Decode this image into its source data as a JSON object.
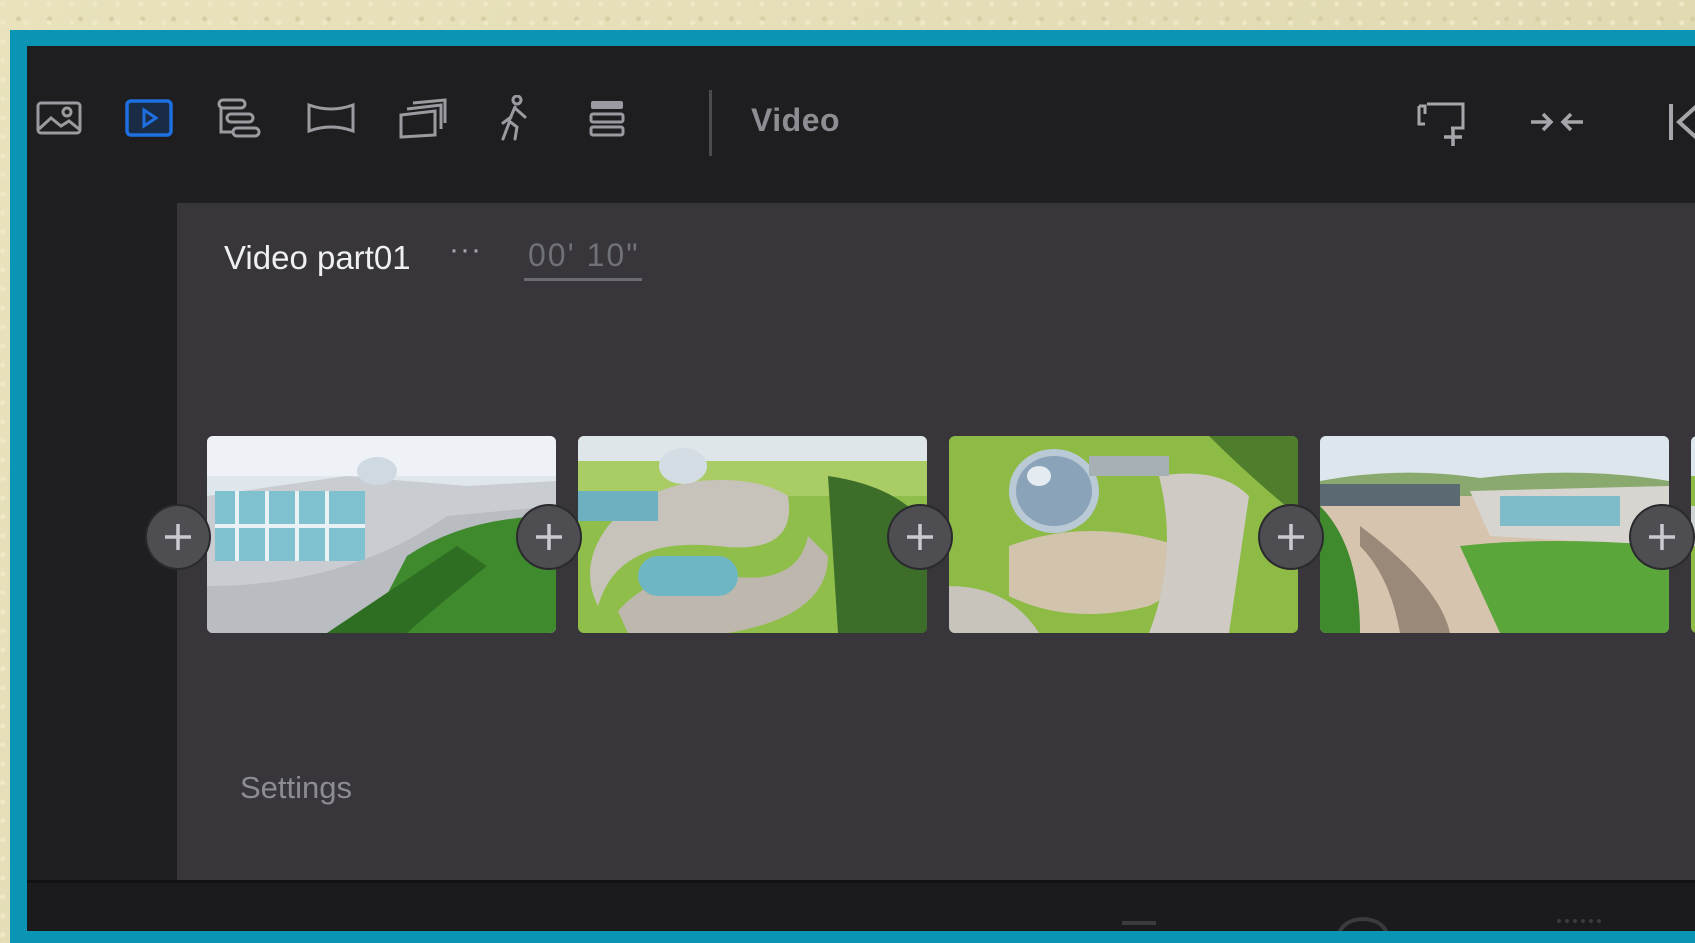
{
  "toolbar": {
    "tools": [
      {
        "name": "image-mode-icon"
      },
      {
        "name": "video-mode-icon",
        "active": true
      },
      {
        "name": "path-animation-icon"
      },
      {
        "name": "panorama-icon"
      },
      {
        "name": "multi-frame-icon"
      },
      {
        "name": "walk-icon"
      },
      {
        "name": "layers-icon"
      }
    ],
    "mode_title": "Video",
    "right_tools": [
      {
        "name": "add-camera-icon"
      },
      {
        "name": "collapse-icon"
      },
      {
        "name": "skip-back-icon"
      }
    ]
  },
  "panel": {
    "part_title": "Video part01",
    "more_label": "···",
    "duration": "00' 10\"",
    "settings_label": "Settings"
  },
  "clips": [
    {
      "name": "clip-thumbnail-1",
      "scene": "building-with-glass-facade"
    },
    {
      "name": "clip-thumbnail-2",
      "scene": "curved-building-aerial"
    },
    {
      "name": "clip-thumbnail-3",
      "scene": "dome-plaza"
    },
    {
      "name": "clip-thumbnail-4",
      "scene": "courtyard-lawn"
    }
  ],
  "colors": {
    "accent": "#1e6fe0",
    "border": "#0a95b5",
    "panel": "#38363b",
    "toolbar": "#1e1e20"
  }
}
